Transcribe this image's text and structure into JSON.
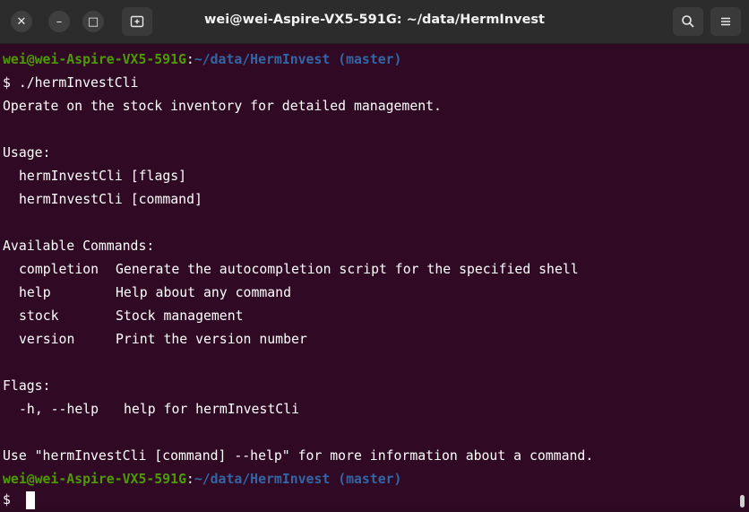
{
  "window": {
    "title": "wei@wei-Aspire-VX5-591G: ~/data/HermInvest"
  },
  "titlebar": {
    "close_glyph": "✕",
    "min_glyph": "–",
    "max_glyph": "□"
  },
  "prompt": {
    "userhost": "wei@wei-Aspire-VX5-591G",
    "sep": ":",
    "path": "~/data/HermInvest",
    "branch": " (master)",
    "symbol": "$ "
  },
  "commands": {
    "entered": "./hermInvestCli"
  },
  "output": {
    "intro": "Operate on the stock inventory for detailed management.",
    "usage_header": "Usage:",
    "usage": [
      "hermInvestCli [flags]",
      "hermInvestCli [command]"
    ],
    "available_header": "Available Commands:",
    "available": [
      {
        "name": "completion",
        "desc": "Generate the autocompletion script for the specified shell"
      },
      {
        "name": "help",
        "desc": "Help about any command"
      },
      {
        "name": "stock",
        "desc": "Stock management"
      },
      {
        "name": "version",
        "desc": "Print the version number"
      }
    ],
    "flags_header": "Flags:",
    "flags": [
      {
        "name": "-h, --help",
        "desc": "help for hermInvestCli"
      }
    ],
    "footer": "Use \"hermInvestCli [command] --help\" for more information about a command."
  },
  "colors": {
    "background": "#300a24",
    "user": "#4e9a06",
    "path": "#3465a4",
    "text": "#ffffff",
    "titlebar": "#2c2c2c"
  }
}
